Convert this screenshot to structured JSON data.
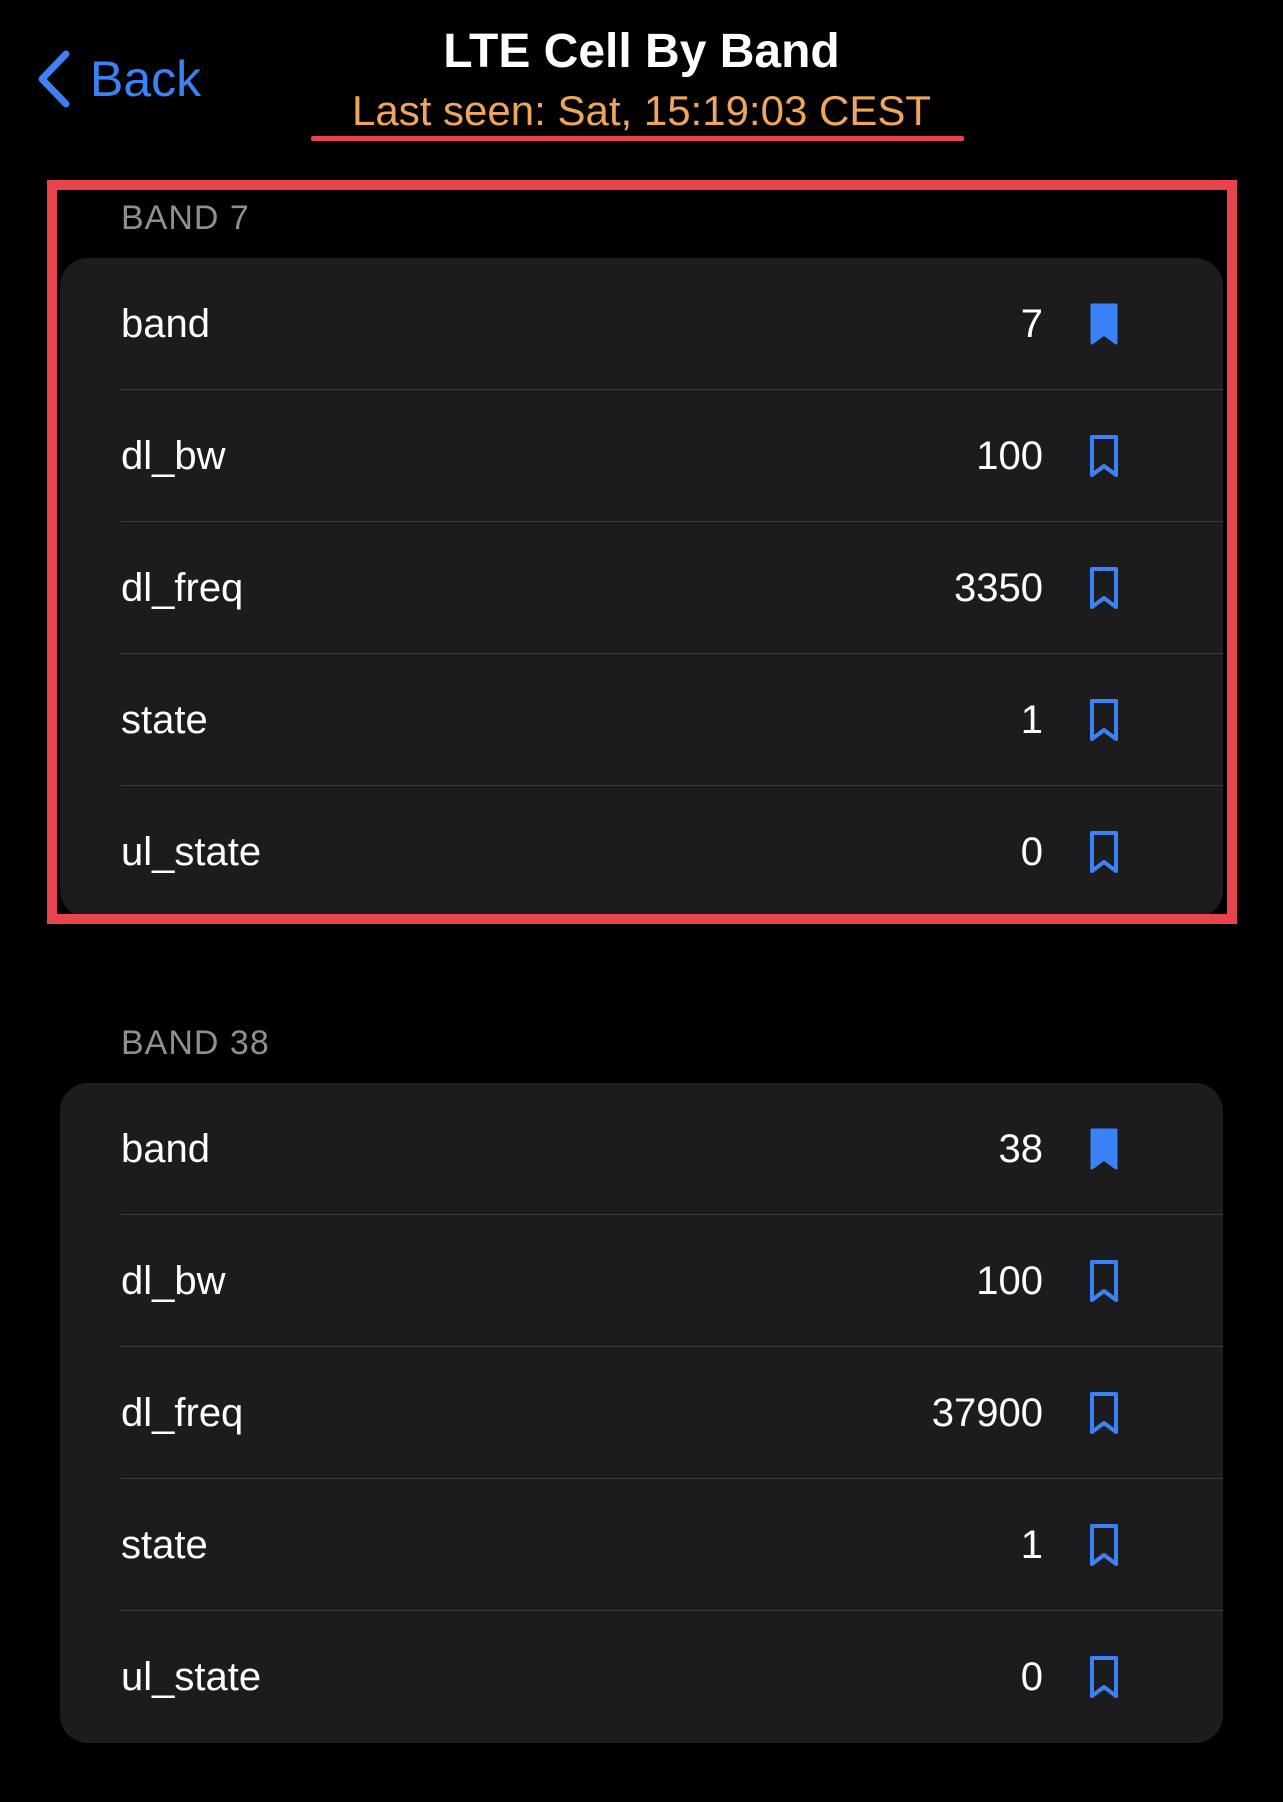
{
  "nav": {
    "back_label": "Back",
    "title": "LTE Cell By Band",
    "subtitle": "Last seen: Sat, 15:19:03 CEST"
  },
  "colors": {
    "accent": "#3b82f6",
    "subtitle": "#f0a65a",
    "highlight": "#e8444d",
    "group_bg": "#1c1c1e"
  },
  "sections": [
    {
      "header": "BAND 7",
      "rows": [
        {
          "label": "band",
          "value": "7",
          "bookmarked": true
        },
        {
          "label": "dl_bw",
          "value": "100",
          "bookmarked": false
        },
        {
          "label": "dl_freq",
          "value": "3350",
          "bookmarked": false
        },
        {
          "label": "state",
          "value": "1",
          "bookmarked": false
        },
        {
          "label": "ul_state",
          "value": "0",
          "bookmarked": false
        }
      ]
    },
    {
      "header": "BAND 38",
      "rows": [
        {
          "label": "band",
          "value": "38",
          "bookmarked": true
        },
        {
          "label": "dl_bw",
          "value": "100",
          "bookmarked": false
        },
        {
          "label": "dl_freq",
          "value": "37900",
          "bookmarked": false
        },
        {
          "label": "state",
          "value": "1",
          "bookmarked": false
        },
        {
          "label": "ul_state",
          "value": "0",
          "bookmarked": false
        }
      ]
    }
  ]
}
